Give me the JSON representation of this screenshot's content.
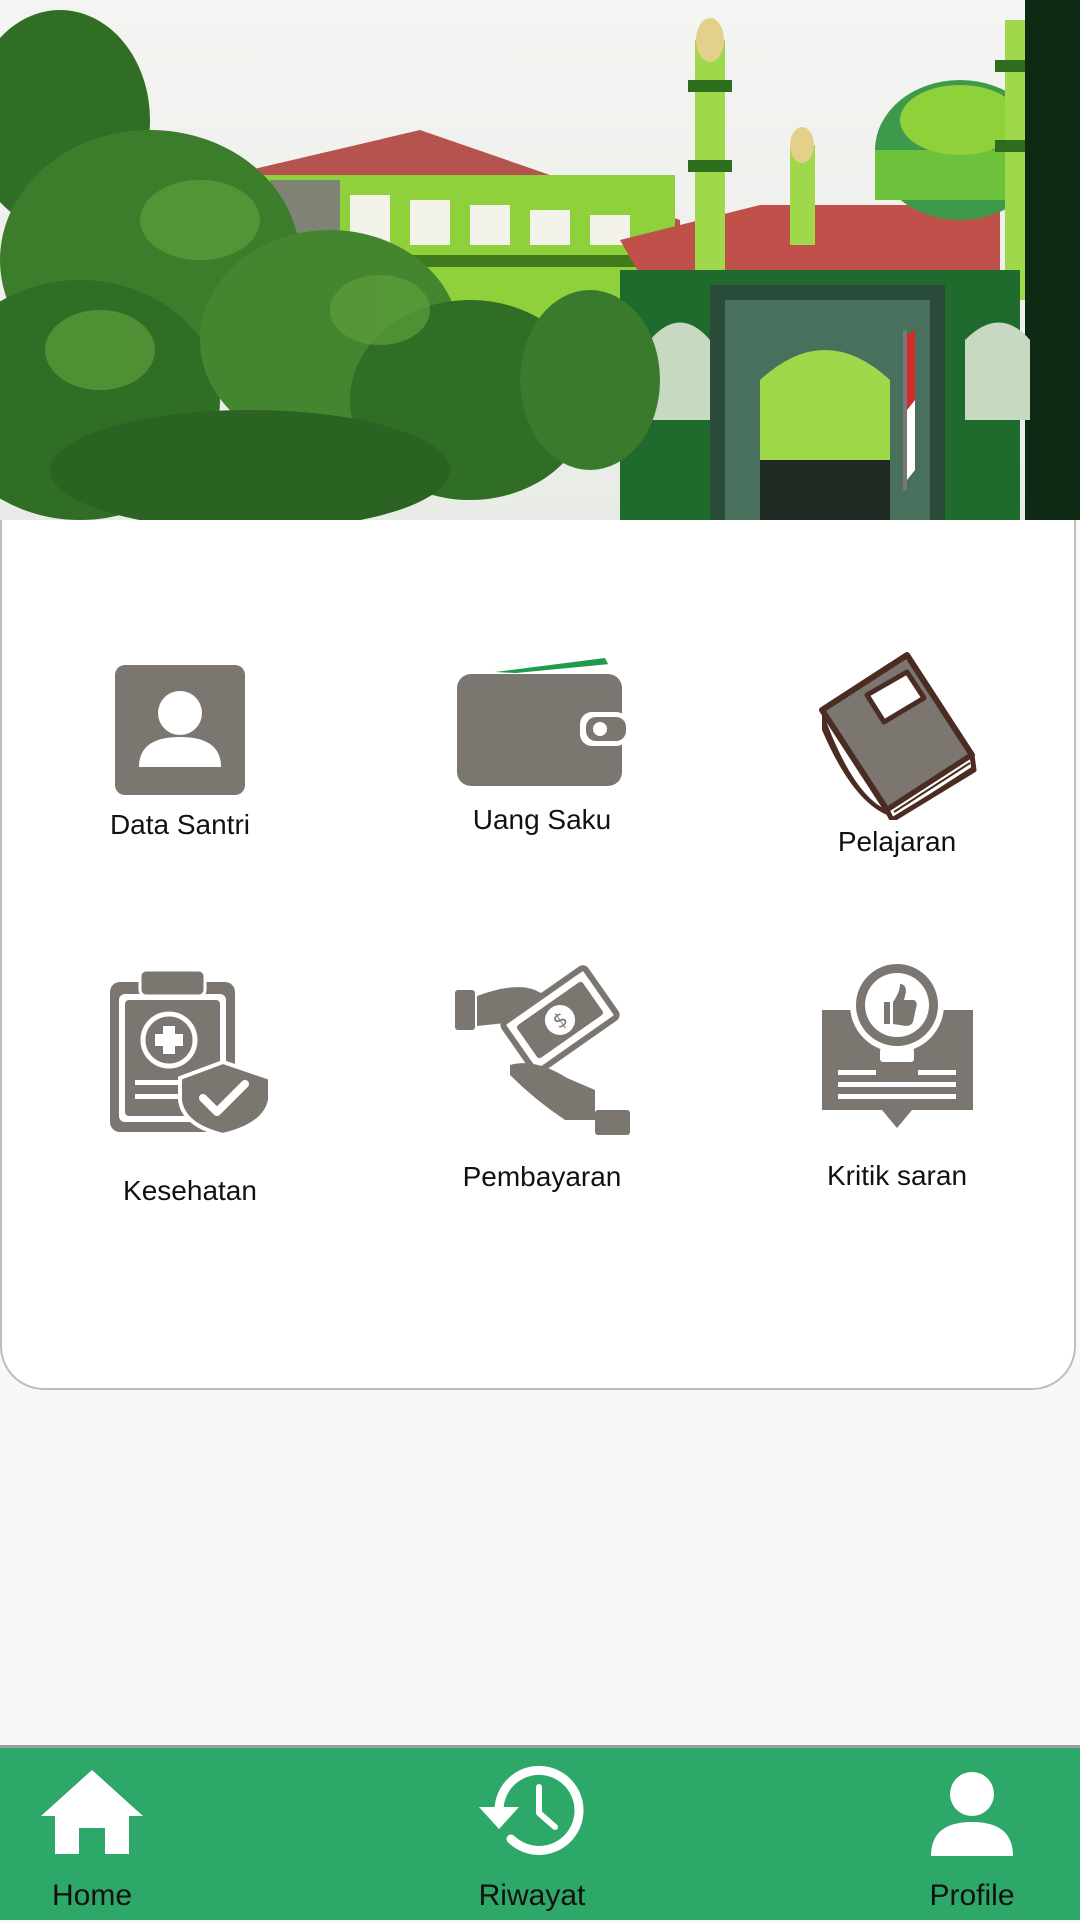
{
  "hero": {
    "image_description": ""
  },
  "menu": [
    {
      "label": "Data Santri",
      "icon": "person-card-icon"
    },
    {
      "label": "Uang Saku",
      "icon": "wallet-icon"
    },
    {
      "label": "Pelajaran",
      "icon": "book-icon"
    },
    {
      "label": "Kesehatan",
      "icon": "medical-clipboard-icon"
    },
    {
      "label": "Pembayaran",
      "icon": "payment-hand-icon"
    },
    {
      "label": "Kritik saran",
      "icon": "feedback-bulb-icon"
    }
  ],
  "nav": {
    "home": {
      "label": "Home",
      "icon": "home-icon"
    },
    "history": {
      "label": "Riwayat",
      "icon": "history-icon"
    },
    "profile": {
      "label": "Profile",
      "icon": "profile-icon"
    }
  },
  "colors": {
    "nav_green": "#2ea869",
    "icon_gray": "#7b7670",
    "book_brown": "#4a2c22"
  }
}
